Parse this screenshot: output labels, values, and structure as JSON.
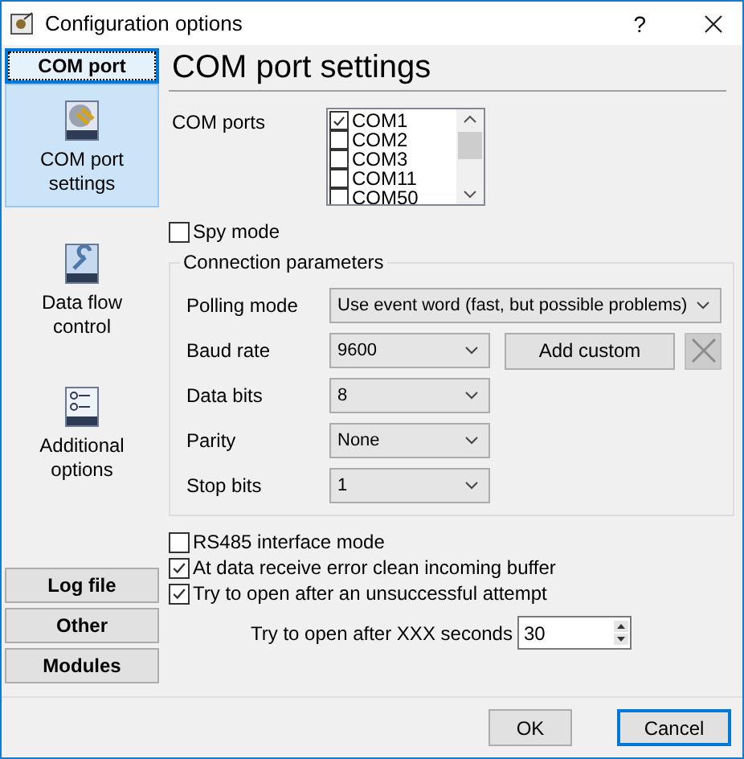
{
  "window": {
    "title": "Configuration options",
    "help": "?"
  },
  "sidebar": {
    "sections": [
      {
        "label": "COM port",
        "expanded": true,
        "items": [
          {
            "label": "COM port settings",
            "kind": "plug",
            "selected": true
          },
          {
            "label": "Data flow control",
            "kind": "wrench",
            "selected": false
          },
          {
            "label": "Additional options",
            "kind": "list",
            "selected": false
          }
        ]
      },
      {
        "label": "Log file",
        "expanded": false
      },
      {
        "label": "Other",
        "expanded": false
      },
      {
        "label": "Modules",
        "expanded": false
      }
    ]
  },
  "panel": {
    "heading": "COM port settings",
    "com_ports": {
      "label": "COM ports",
      "items": [
        {
          "label": "COM1",
          "checked": true
        },
        {
          "label": "COM2",
          "checked": false
        },
        {
          "label": "COM3",
          "checked": false
        },
        {
          "label": "COM11",
          "checked": false
        },
        {
          "label": "COM50",
          "checked": false
        }
      ]
    },
    "spy_mode": {
      "label": "Spy mode",
      "checked": false
    },
    "connection": {
      "title": "Connection parameters",
      "rows": [
        {
          "label": "Polling mode",
          "kind": "wide",
          "value": "Use event word (fast, but possible problems)"
        },
        {
          "label": "Baud rate",
          "kind": "narrow",
          "value": "9600",
          "buttons": [
            {
              "kind": "text",
              "label": "Add custom",
              "disabled": false
            },
            {
              "kind": "remove",
              "disabled": true
            }
          ]
        },
        {
          "label": "Data bits",
          "kind": "narrow",
          "value": "8"
        },
        {
          "label": "Parity",
          "kind": "narrow",
          "value": "None"
        },
        {
          "label": "Stop bits",
          "kind": "narrow",
          "value": "1"
        }
      ]
    },
    "options": [
      {
        "label": "RS485 interface mode",
        "checked": false
      },
      {
        "label": "At data receive error clean incoming buffer",
        "checked": true
      },
      {
        "label": "Try to open after an unsuccessful attempt",
        "checked": true
      }
    ],
    "retry": {
      "label": "Try to open after XXX seconds",
      "value": "30"
    }
  },
  "footer": {
    "buttons": [
      {
        "label": "OK",
        "default": false
      },
      {
        "label": "Cancel",
        "default": true
      }
    ]
  }
}
